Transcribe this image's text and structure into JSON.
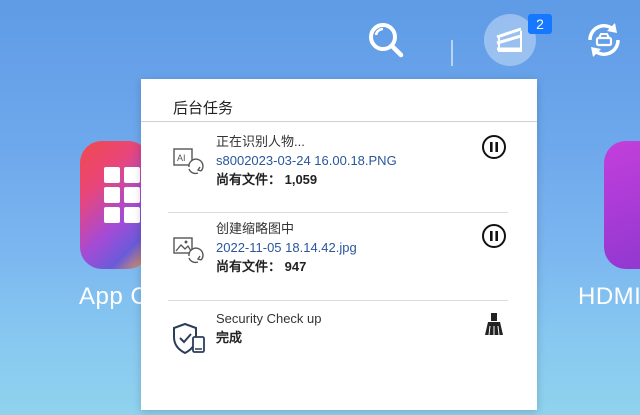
{
  "topbar": {
    "tasks_badge": "2",
    "icons": [
      "search-icon",
      "background-tasks-icon",
      "sync-device-icon"
    ]
  },
  "background_apps": [
    {
      "label": "App C"
    },
    {
      "label": "HDMI"
    }
  ],
  "panel": {
    "title": "后台任务",
    "tasks": [
      {
        "icon": "ai-recognition-icon",
        "status": "正在识别人物...",
        "file": "s8002023-03-24 16.00.18.PNG",
        "remaining": "尚有文件： 1,059",
        "action_icon": "pause-icon"
      },
      {
        "icon": "thumbnail-image-icon",
        "status": "创建缩略图中",
        "file": "2022-11-05 18.14.42.jpg",
        "remaining": "尚有文件： 947",
        "action_icon": "pause-icon"
      },
      {
        "icon": "security-shield-icon",
        "status": "Security Check up",
        "file": "",
        "remaining": "完成",
        "action_icon": "clear-broom-icon"
      }
    ]
  },
  "colors": {
    "accent": "#1677ff",
    "file_link": "#27579c"
  }
}
